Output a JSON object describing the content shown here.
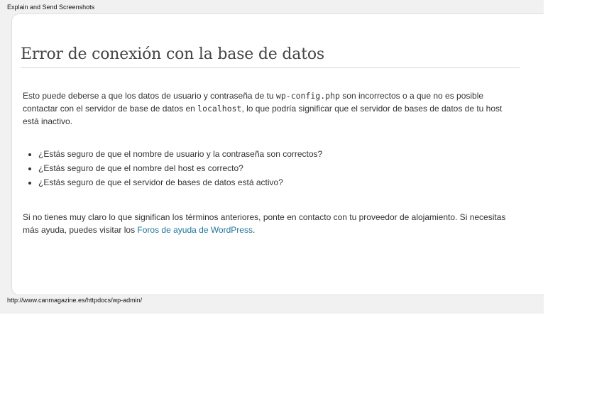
{
  "window": {
    "title": "Explain and Send Screenshots",
    "status_url": "http://www.canmagazine.es/httpdocs/wp-admin/"
  },
  "error": {
    "heading": "Error de conexión con la base de datos",
    "intro": {
      "part1": "Esto puede deberse a que los datos de usuario y contraseña de tu ",
      "config_file": "wp-config.php",
      "part2": " son incorrectos o a que no es posible contactar con el servidor de base de datos en ",
      "host": "localhost",
      "part3": ", lo que podría significar que el servidor de bases de datos de tu host está inactivo."
    },
    "questions": [
      "¿Estás seguro de que el nombre de usuario y la contraseña son correctos?",
      "¿Estás seguro de que el nombre del host es correcto?",
      "¿Estás seguro de que el servidor de bases de datos está activo?"
    ],
    "help": {
      "text": "Si no tienes muy claro lo que significan los términos anteriores, ponte en contacto con tu proveedor de alojamiento. Si necesitas más ayuda, puedes visitar los ",
      "link_label": "Foros de ayuda de WordPress",
      "suffix": "."
    }
  },
  "colors": {
    "link": "#21759b",
    "heading": "#464646",
    "text": "#333333",
    "frame_background": "#f1f1f1"
  }
}
